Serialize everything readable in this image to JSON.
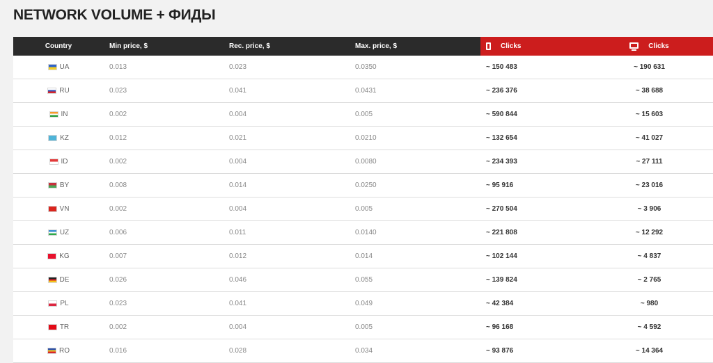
{
  "page": {
    "title": "NETWORK VOLUME + ФИДЫ"
  },
  "table": {
    "headers": {
      "country": "Country",
      "min_price": "Min price, $",
      "rec_price": "Rec. price, $",
      "max_price": "Max. price, $",
      "mobile_clicks": "Clicks",
      "desktop_clicks": "Clicks"
    },
    "header_icons": {
      "mobile": "mobile-phone-icon",
      "desktop": "desktop-monitor-icon"
    },
    "accent_color": "#cc1d1d",
    "header_color": "#2b2b2b",
    "rows": [
      {
        "code": "UA",
        "flag": [
          "#2f64c8",
          "#f5cf22"
        ],
        "min": "0.013",
        "rec": "0.023",
        "max": "0.0350",
        "mobile": "~ 150 483",
        "desktop": "~ 190 631"
      },
      {
        "code": "RU",
        "flag": [
          "#ffffff",
          "#2d4fb8",
          "#d7262c"
        ],
        "min": "0.023",
        "rec": "0.041",
        "max": "0.0431",
        "mobile": "~ 236 376",
        "desktop": "~ 38 688"
      },
      {
        "code": "IN",
        "flag": [
          "#f39a2c",
          "#ffffff",
          "#2e9e3f"
        ],
        "min": "0.002",
        "rec": "0.004",
        "max": "0.005",
        "mobile": "~ 590 844",
        "desktop": "~ 15 603"
      },
      {
        "code": "KZ",
        "flag": [
          "#4fb4d8"
        ],
        "min": "0.012",
        "rec": "0.021",
        "max": "0.0210",
        "mobile": "~ 132 654",
        "desktop": "~ 41 027"
      },
      {
        "code": "ID",
        "flag": [
          "#e23a3a",
          "#ffffff"
        ],
        "min": "0.002",
        "rec": "0.004",
        "max": "0.0080",
        "mobile": "~ 234 393",
        "desktop": "~ 27 111"
      },
      {
        "code": "BY",
        "flag": [
          "#c8313e",
          "#4aa657"
        ],
        "min": "0.008",
        "rec": "0.014",
        "max": "0.0250",
        "mobile": "~ 95 916",
        "desktop": "~ 23 016"
      },
      {
        "code": "VN",
        "flag": [
          "#da251d"
        ],
        "min": "0.002",
        "rec": "0.004",
        "max": "0.005",
        "mobile": "~ 270 504",
        "desktop": "~ 3 906"
      },
      {
        "code": "UZ",
        "flag": [
          "#3b8fd0",
          "#ffffff",
          "#2ea84a"
        ],
        "min": "0.006",
        "rec": "0.011",
        "max": "0.0140",
        "mobile": "~ 221 808",
        "desktop": "~ 12 292"
      },
      {
        "code": "KG",
        "flag": [
          "#e8112d"
        ],
        "min": "0.007",
        "rec": "0.012",
        "max": "0.014",
        "mobile": "~ 102 144",
        "desktop": "~ 4 837"
      },
      {
        "code": "DE",
        "flag": [
          "#222222",
          "#dd1f26",
          "#f5c518"
        ],
        "min": "0.026",
        "rec": "0.046",
        "max": "0.055",
        "mobile": "~ 139 824",
        "desktop": "~ 2 765"
      },
      {
        "code": "PL",
        "flag": [
          "#ffffff",
          "#dc2640"
        ],
        "min": "0.023",
        "rec": "0.041",
        "max": "0.049",
        "mobile": "~ 42 384",
        "desktop": "~ 980"
      },
      {
        "code": "TR",
        "flag": [
          "#e30a17"
        ],
        "min": "0.002",
        "rec": "0.004",
        "max": "0.005",
        "mobile": "~ 96 168",
        "desktop": "~ 4 592"
      },
      {
        "code": "RO",
        "flag": [
          "#2a4ea8",
          "#f5cf22",
          "#d7262c"
        ],
        "min": "0.016",
        "rec": "0.028",
        "max": "0.034",
        "mobile": "~ 93 876",
        "desktop": "~ 14 364"
      }
    ]
  }
}
